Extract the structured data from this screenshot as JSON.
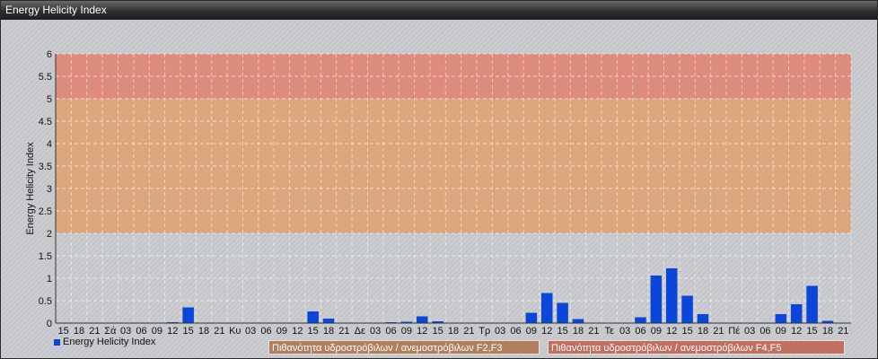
{
  "window": {
    "title": "Energy Helicity Index"
  },
  "zones": [
    {
      "label": "Πιθανότητα υδροστρόβιλων / ανεμοστρόβιλων F2,F3",
      "color": "#b07f5f"
    },
    {
      "label": "Πιθανότητα υδροστρόβιλων / ανεμοστρόβιλων F4,F5",
      "color": "#c07060"
    }
  ],
  "chart_data": {
    "type": "bar",
    "title": "",
    "ylabel": "Energy Helicity Index",
    "xlabel": "",
    "ylim": [
      0,
      6
    ],
    "yticks": [
      "0",
      "0.5",
      "1",
      "1.5",
      "2",
      "2.5",
      "3",
      "3.5",
      "4",
      "4.5",
      "5",
      "5.5",
      "6"
    ],
    "grid": true,
    "legend_position": "bottom-left",
    "bands": [
      {
        "from": 2,
        "to": 5,
        "color": "#e0a070"
      },
      {
        "from": 5,
        "to": 6,
        "color": "#e08070"
      }
    ],
    "categories": [
      "15",
      "18",
      "21",
      "Σά",
      "03",
      "06",
      "09",
      "12",
      "15",
      "18",
      "21",
      "Κυ",
      "03",
      "06",
      "09",
      "12",
      "15",
      "18",
      "21",
      "Δε",
      "03",
      "06",
      "09",
      "12",
      "15",
      "18",
      "21",
      "Τρ",
      "03",
      "06",
      "09",
      "12",
      "15",
      "18",
      "21",
      "Τε",
      "03",
      "06",
      "09",
      "12",
      "15",
      "18",
      "21",
      "Πέ",
      "03",
      "06",
      "09",
      "12",
      "15",
      "18",
      "21"
    ],
    "series": [
      {
        "name": "Energy Helicity Index",
        "color": "#0b46d8",
        "values": [
          0.01,
          0.01,
          0.01,
          0.01,
          0.01,
          0.01,
          0.01,
          0.02,
          0.35,
          0.01,
          0.01,
          0.01,
          0.01,
          0.01,
          0.01,
          0.01,
          0.26,
          0.1,
          0.01,
          0.01,
          0.01,
          0.02,
          0.03,
          0.15,
          0.04,
          0.01,
          0.01,
          0.01,
          0.01,
          0.01,
          0.23,
          0.67,
          0.45,
          0.09,
          0.01,
          0.01,
          0.01,
          0.13,
          1.06,
          1.22,
          0.61,
          0.2,
          0.01,
          0.01,
          0.01,
          0.01,
          0.2,
          0.42,
          0.83,
          0.05,
          0.01
        ]
      }
    ]
  }
}
